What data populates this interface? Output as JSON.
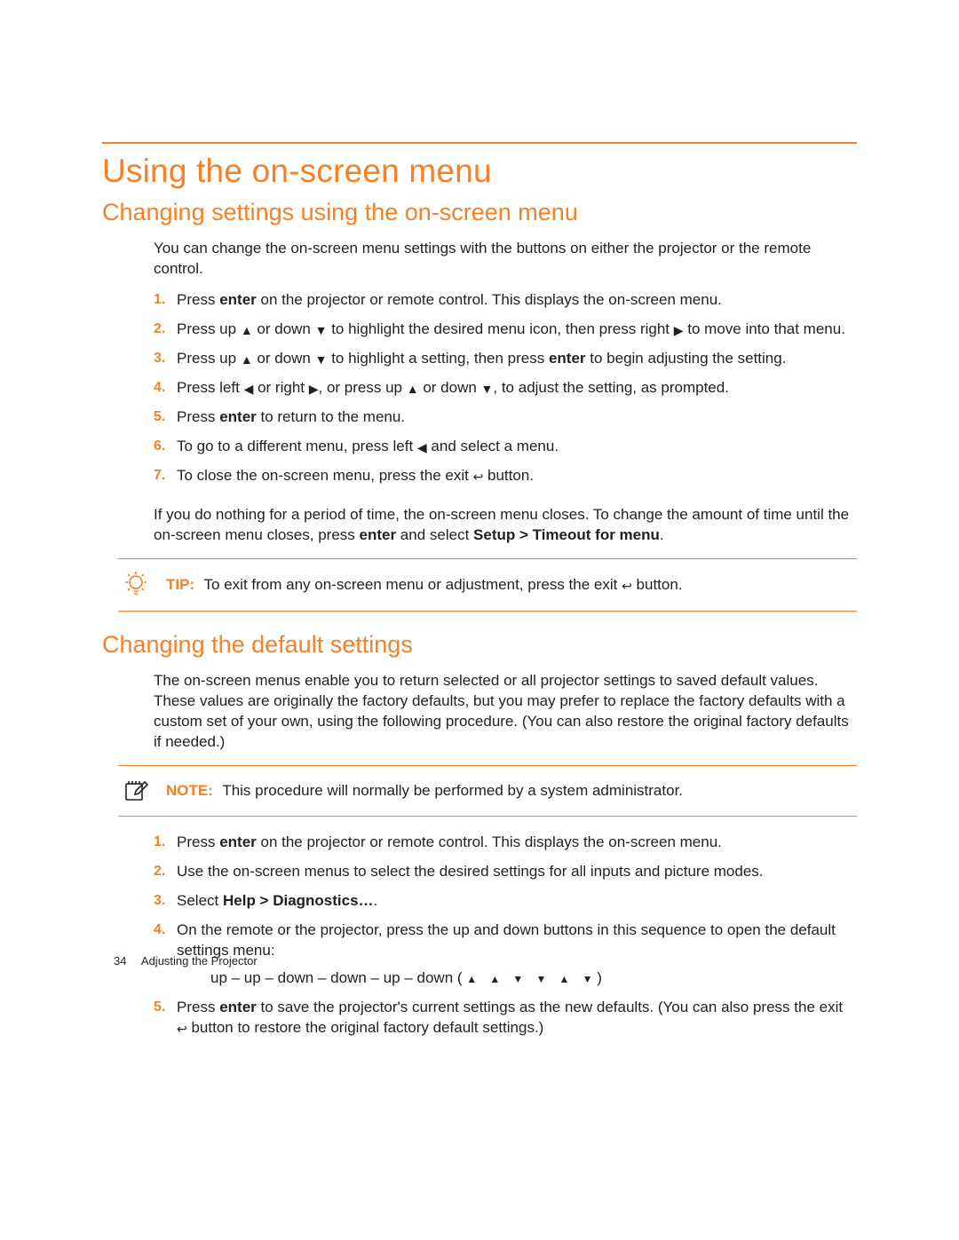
{
  "page": {
    "number": "34",
    "running_head": "Adjusting the Projector"
  },
  "h1": "Using the on-screen menu",
  "section1": {
    "title": "Changing settings using the on-screen menu",
    "intro": "You can change the on-screen menu settings with the buttons on either the projector or the remote control.",
    "steps": {
      "s1a": "Press ",
      "s1b": "enter",
      "s1c": " on the projector or remote control. This displays the on-screen menu.",
      "s2a": "Press up ",
      "s2b": " or down ",
      "s2c": " to highlight the desired menu icon, then press right ",
      "s2d": " to move into that menu.",
      "s3a": "Press up ",
      "s3b": " or down ",
      "s3c": " to highlight a setting, then press ",
      "s3d": "enter",
      "s3e": " to begin adjusting the setting.",
      "s4a": "Press left ",
      "s4b": " or right ",
      "s4c": ", or press up ",
      "s4d": " or down ",
      "s4e": ", to adjust the setting, as prompted.",
      "s5a": "Press ",
      "s5b": "enter",
      "s5c": " to return to the menu.",
      "s6a": "To go to a different menu, press left ",
      "s6b": " and select a menu.",
      "s7a": "To close the on-screen menu, press the exit ",
      "s7b": " button."
    },
    "after_a": "If you do nothing for a period of time, the on-screen menu closes. To change the amount of time until the on-screen menu closes, press ",
    "after_b": "enter",
    "after_c": " and select ",
    "after_d": "Setup > Timeout for menu",
    "after_e": ".",
    "tip_label": "TIP:",
    "tip_a": "To exit from any on-screen menu or adjustment, press the exit ",
    "tip_b": " button."
  },
  "section2": {
    "title": "Changing the default settings",
    "intro": "The on-screen menus enable you to return selected or all projector settings to saved default values. These values are originally the factory defaults, but you may prefer to replace the factory defaults with a custom set of your own, using the following procedure. (You can also restore the original factory defaults if needed.)",
    "note_label": "NOTE:",
    "note_text": "This procedure will normally be performed by a system administrator.",
    "steps": {
      "s1a": "Press ",
      "s1b": "enter",
      "s1c": " on the projector or remote control. This displays the on-screen menu.",
      "s2": "Use the on-screen menus to select the desired settings for all inputs and picture modes.",
      "s3a": "Select ",
      "s3b": "Help > Diagnostics…",
      "s3c": ".",
      "s4": "On the remote or the projector, press the up and down buttons in this sequence to open the default settings menu:",
      "s4_seq_a": "up – up – down – down – up – down ( ",
      "s4_seq_b": " )",
      "s5a": "Press ",
      "s5b": "enter",
      "s5c": " to save the projector's current settings as the new defaults. (You can also press the exit ",
      "s5d": " button to restore the original factory default settings.)"
    }
  },
  "nums": {
    "n1": "1.",
    "n2": "2.",
    "n3": "3.",
    "n4": "4.",
    "n5": "5.",
    "n6": "6.",
    "n7": "7."
  }
}
